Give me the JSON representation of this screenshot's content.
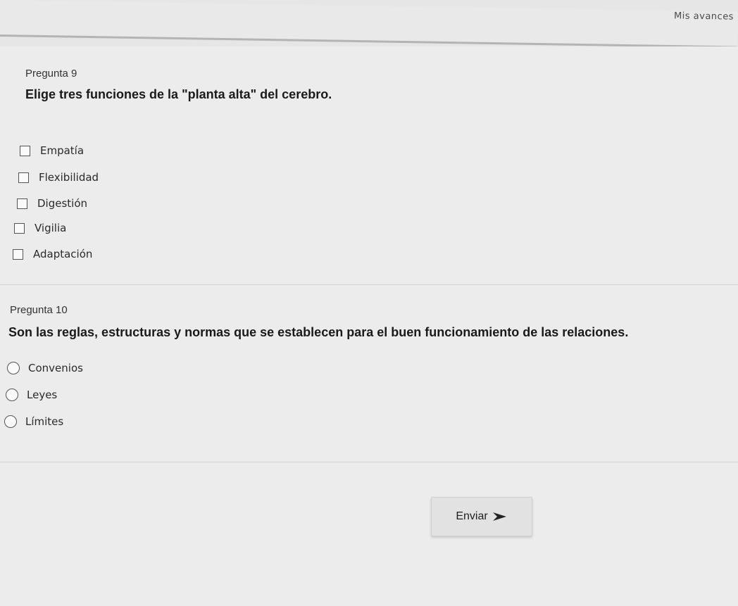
{
  "header": {
    "progress_link": "Mis avances"
  },
  "questions": [
    {
      "number": "Pregunta 9",
      "text": "Elige tres funciones de la \"planta alta\" del cerebro.",
      "input_type": "checkbox",
      "options": [
        "Empatía",
        "Flexibilidad",
        "Digestión",
        "Vigilia",
        "Adaptación"
      ]
    },
    {
      "number": "Pregunta 10",
      "text": "Son las reglas, estructuras y normas que se establecen para el buen funcionamiento de las relaciones.",
      "input_type": "radio",
      "options": [
        "Convenios",
        "Leyes",
        "Límites"
      ]
    }
  ],
  "submit": {
    "label": "Enviar",
    "icon": "arrow-right-icon"
  },
  "colors": {
    "background": "#e6e6e6",
    "text": "#1e1e1e",
    "border": "#555555"
  }
}
